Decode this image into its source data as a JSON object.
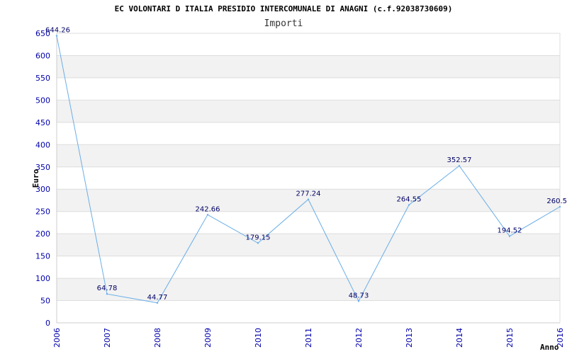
{
  "chart_data": {
    "type": "line",
    "title": "EC VOLONTARI D ITALIA PRESIDIO INTERCOMUNALE DI ANAGNI (c.f.92038730609)",
    "subtitle": "Importi",
    "xlabel": "Anno",
    "ylabel": "Euro",
    "categories": [
      "2006",
      "2007",
      "2008",
      "2009",
      "2010",
      "2011",
      "2012",
      "2013",
      "2014",
      "2015",
      "2016"
    ],
    "series": [
      {
        "values": [
          644.26,
          64.78,
          44.77,
          242.66,
          179.15,
          277.24,
          48.73,
          264.55,
          352.57,
          194.52,
          260.5
        ]
      }
    ],
    "data_labels": [
      "644.26",
      "64.78",
      "44.77",
      "242.66",
      "179.15",
      "277.24",
      "48.73",
      "264.55",
      "352.57",
      "194.52",
      "260.5"
    ],
    "y_ticks": [
      "0",
      "50",
      "100",
      "150",
      "200",
      "250",
      "300",
      "350",
      "400",
      "450",
      "500",
      "550",
      "600",
      "650"
    ],
    "ylim": [
      0,
      650
    ],
    "grid": "horizontal alternating bands",
    "colors": {
      "line": "#6aaee8",
      "band": "#f2f2f2",
      "grid": "#dddddd",
      "tick_text": "#0000aa",
      "data_label": "#000066"
    }
  }
}
